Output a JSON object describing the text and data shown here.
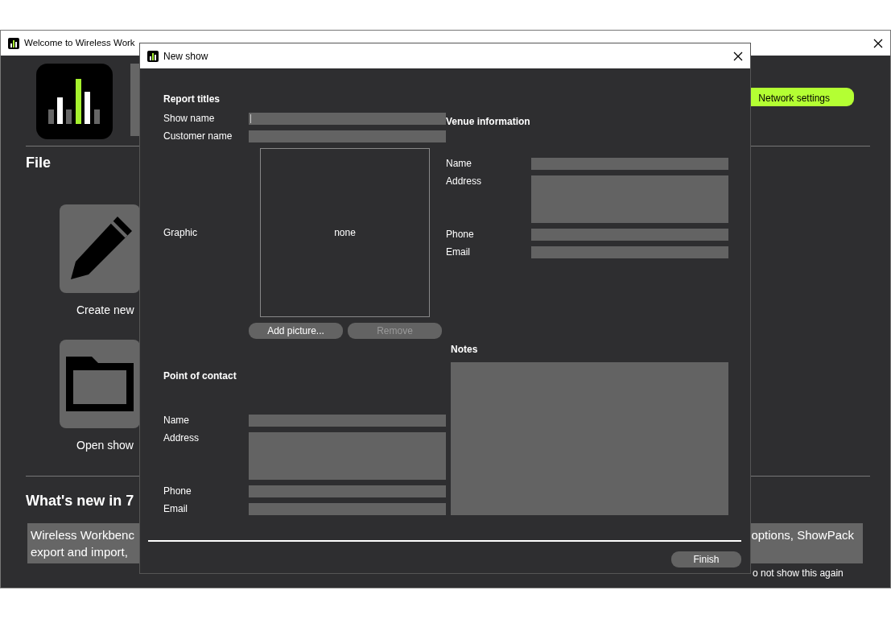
{
  "main_window": {
    "title": "Welcome to Wireless Work",
    "network_button": {
      "label": "Network settings"
    },
    "file_section": {
      "heading": "File",
      "tiles": [
        {
          "kind": "create",
          "label": "Create new"
        },
        {
          "kind": "open",
          "label": "Open show"
        }
      ]
    },
    "whats_new": {
      "heading": "What's new in 7",
      "lines_left": [
        "Wireless Workbenc",
        "export and import,"
      ],
      "line_right": "options, ShowPack"
    },
    "dont_show_again": "o not show this again"
  },
  "dialog": {
    "title": "New show",
    "report_titles": {
      "heading": "Report titles",
      "fields": [
        {
          "label": "Show name",
          "kind": "line",
          "focused": true
        },
        {
          "label": "Customer name",
          "kind": "line",
          "focused": false
        }
      ]
    },
    "graphic": {
      "label": "Graphic",
      "preview": "none",
      "buttons": [
        {
          "label": "Add picture...",
          "disabled": false
        },
        {
          "label": "Remove",
          "disabled": true
        }
      ]
    },
    "point_of_contact": {
      "heading": "Point of contact",
      "fields": [
        {
          "label": "Name",
          "kind": "line",
          "focused": false
        },
        {
          "label": "Address",
          "kind": "area",
          "focused": false
        },
        {
          "label": "Phone",
          "kind": "line",
          "focused": false
        },
        {
          "label": "Email",
          "kind": "line",
          "focused": false
        }
      ]
    },
    "venue_information": {
      "heading": "Venue information",
      "fields": [
        {
          "label": "Name",
          "kind": "line",
          "focused": false
        },
        {
          "label": "Address",
          "kind": "area",
          "focused": false
        },
        {
          "label": "Phone",
          "kind": "line",
          "focused": false
        },
        {
          "label": "Email",
          "kind": "line",
          "focused": false
        }
      ]
    },
    "notes": {
      "heading": "Notes"
    },
    "finish_button": {
      "label": "Finish"
    }
  }
}
